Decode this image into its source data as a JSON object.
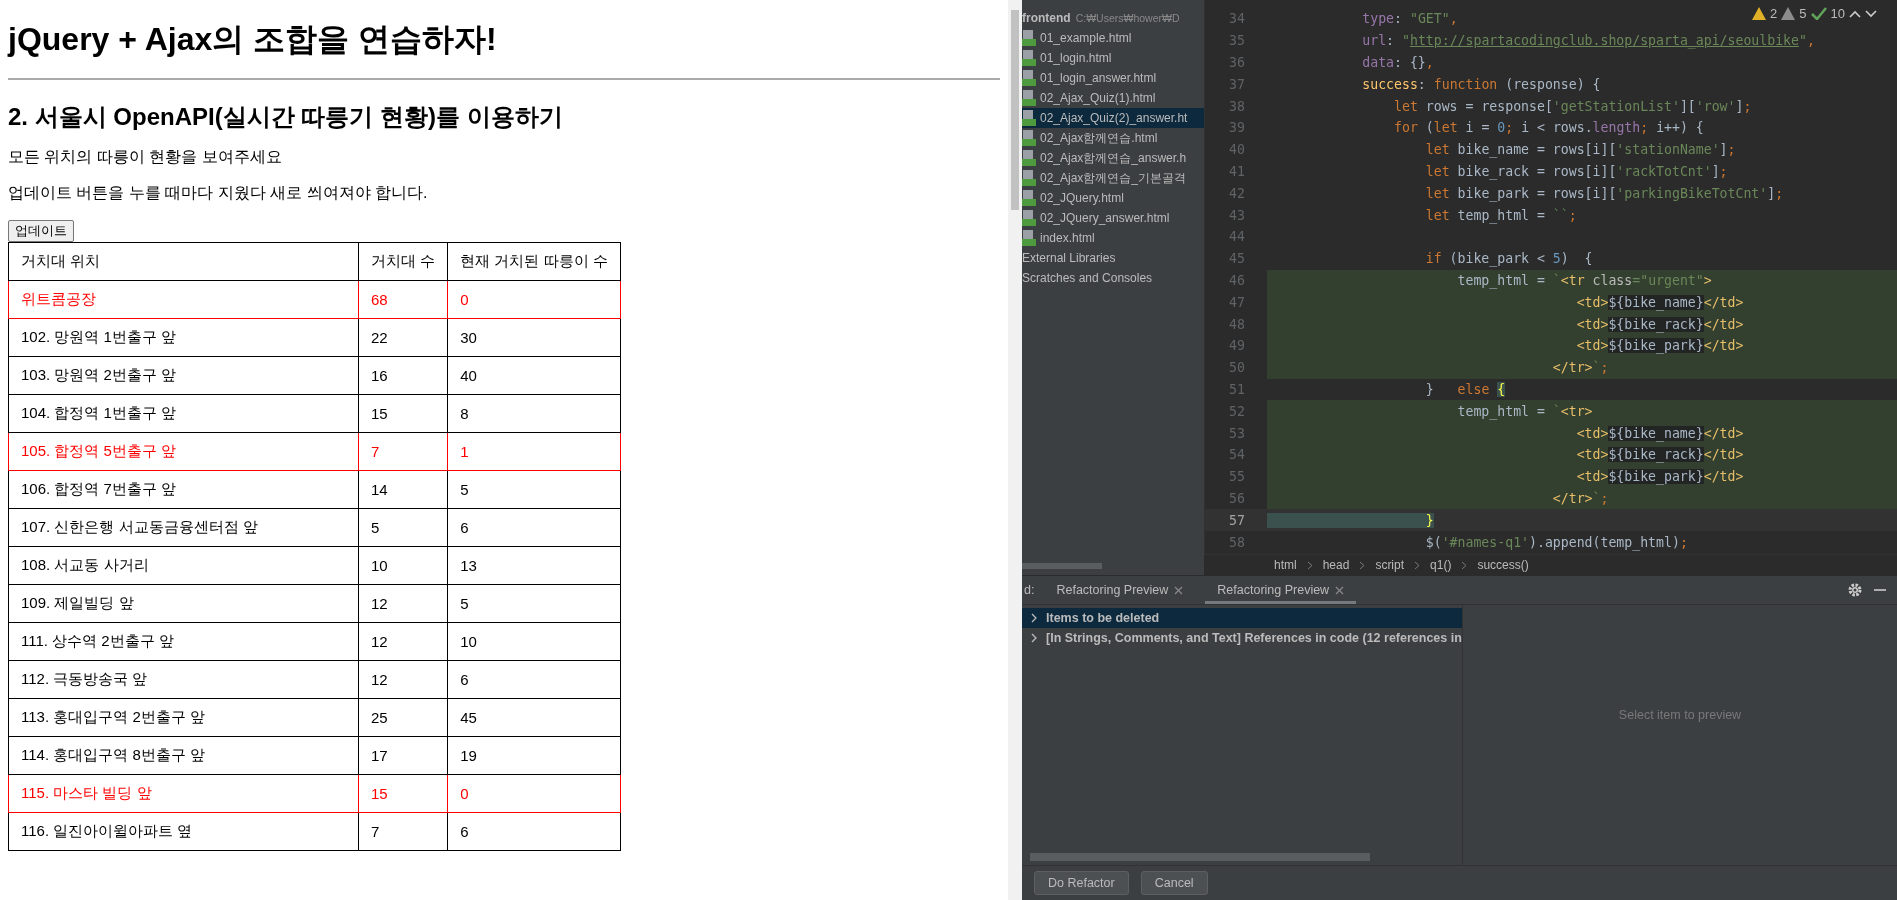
{
  "page": {
    "title": "jQuery + Ajax의 조합을 연습하자!",
    "subtitle": "2. 서울시 OpenAPI(실시간 따릉기 현황)를 이용하기",
    "paragraphs": [
      "모든 위치의 따릉이 현황을 보여주세요",
      "업데이트 버튼을 누를 때마다 지웠다 새로 씌여져야 합니다."
    ],
    "button": "업데이트",
    "table": {
      "columns": [
        "거치대 위치",
        "거치대 수",
        "현재 거치된 따릉이 수"
      ],
      "rows": [
        {
          "cells": [
            "위트콤공장",
            "68",
            "0"
          ],
          "urgent": true
        },
        {
          "cells": [
            "102. 망원역 1번출구 앞",
            "22",
            "30"
          ],
          "urgent": false
        },
        {
          "cells": [
            "103. 망원역 2번출구 앞",
            "16",
            "40"
          ],
          "urgent": false
        },
        {
          "cells": [
            "104. 합정역 1번출구 앞",
            "15",
            "8"
          ],
          "urgent": false
        },
        {
          "cells": [
            "105. 합정역 5번출구 앞",
            "7",
            "1"
          ],
          "urgent": true
        },
        {
          "cells": [
            "106. 합정역 7번출구 앞",
            "14",
            "5"
          ],
          "urgent": false
        },
        {
          "cells": [
            "107. 신한은행 서교동금융센터점 앞",
            "5",
            "6"
          ],
          "urgent": false
        },
        {
          "cells": [
            "108. 서교동 사거리",
            "10",
            "13"
          ],
          "urgent": false
        },
        {
          "cells": [
            "109. 제일빌딩 앞",
            "12",
            "5"
          ],
          "urgent": false
        },
        {
          "cells": [
            "111. 상수역 2번출구 앞",
            "12",
            "10"
          ],
          "urgent": false
        },
        {
          "cells": [
            "112. 극동방송국 앞",
            "12",
            "6"
          ],
          "urgent": false
        },
        {
          "cells": [
            "113. 홍대입구역 2번출구 앞",
            "25",
            "45"
          ],
          "urgent": false
        },
        {
          "cells": [
            "114. 홍대입구역 8번출구 앞",
            "17",
            "19"
          ],
          "urgent": false
        },
        {
          "cells": [
            "115. 마스타 빌딩 앞",
            "15",
            "0"
          ],
          "urgent": true
        },
        {
          "cells": [
            "116. 일진아이윌아파트 옆",
            "7",
            "6"
          ],
          "urgent": false
        }
      ]
    }
  },
  "project": {
    "root": "frontend",
    "path": "C:₩Users₩hower₩D",
    "files": [
      {
        "name": "01_example.html",
        "selected": false
      },
      {
        "name": "01_login.html",
        "selected": false
      },
      {
        "name": "01_login_answer.html",
        "selected": false
      },
      {
        "name": "02_Ajax_Quiz(1).html",
        "selected": false
      },
      {
        "name": "02_Ajax_Quiz(2)_answer.ht",
        "selected": true
      },
      {
        "name": "02_Ajax함께연습.html",
        "selected": false
      },
      {
        "name": "02_Ajax함께연습_answer.h",
        "selected": false
      },
      {
        "name": "02_Ajax함께연습_기본골격",
        "selected": false
      },
      {
        "name": "02_JQuery.html",
        "selected": false
      },
      {
        "name": "02_JQuery_answer.html",
        "selected": false
      },
      {
        "name": "index.html",
        "selected": false
      }
    ],
    "extra": [
      "External Libraries",
      "Scratches and Consoles"
    ]
  },
  "editor": {
    "inspections": {
      "warnings": "2",
      "weak_warnings": "5",
      "typos": "10"
    },
    "lines": [
      {
        "number": "34",
        "highlighted": false,
        "current": false,
        "tokens": [
          {
            "kind": "prop",
            "text": "            type"
          },
          {
            "kind": "plain",
            "text": ": "
          },
          {
            "kind": "string",
            "text": "\"GET\""
          },
          {
            "kind": "punct",
            "text": ","
          }
        ]
      },
      {
        "number": "35",
        "highlighted": false,
        "current": false,
        "tokens": [
          {
            "kind": "prop",
            "text": "            url"
          },
          {
            "kind": "plain",
            "text": ": "
          },
          {
            "kind": "string",
            "text": "\""
          },
          {
            "kind": "url",
            "text": "http://spartacodingclub.shop/sparta_api/seoulbike"
          },
          {
            "kind": "string",
            "text": "\""
          },
          {
            "kind": "punct",
            "text": ","
          }
        ]
      },
      {
        "number": "36",
        "highlighted": false,
        "current": false,
        "tokens": [
          {
            "kind": "prop",
            "text": "            data"
          },
          {
            "kind": "plain",
            "text": ": {}"
          },
          {
            "kind": "punct",
            "text": ","
          }
        ]
      },
      {
        "number": "37",
        "highlighted": false,
        "current": false,
        "tokens": [
          {
            "kind": "func",
            "text": "            success"
          },
          {
            "kind": "plain",
            "text": ": "
          },
          {
            "kind": "keyword",
            "text": "function"
          },
          {
            "kind": "plain",
            "text": " (response) {"
          }
        ]
      },
      {
        "number": "38",
        "highlighted": false,
        "current": false,
        "tokens": [
          {
            "kind": "keyword",
            "text": "                let"
          },
          {
            "kind": "plain",
            "text": " rows = response["
          },
          {
            "kind": "string",
            "text": "'getStationList'"
          },
          {
            "kind": "plain",
            "text": "]["
          },
          {
            "kind": "string",
            "text": "'row'"
          },
          {
            "kind": "plain",
            "text": "]"
          },
          {
            "kind": "punct",
            "text": ";"
          }
        ]
      },
      {
        "number": "39",
        "highlighted": false,
        "current": false,
        "tokens": [
          {
            "kind": "keyword",
            "text": "                for"
          },
          {
            "kind": "plain",
            "text": " ("
          },
          {
            "kind": "keyword",
            "text": "let"
          },
          {
            "kind": "plain",
            "text": " i = "
          },
          {
            "kind": "number",
            "text": "0"
          },
          {
            "kind": "punct",
            "text": ";"
          },
          {
            "kind": "plain",
            "text": " i < rows."
          },
          {
            "kind": "prop",
            "text": "length"
          },
          {
            "kind": "punct",
            "text": ";"
          },
          {
            "kind": "plain",
            "text": " i++) {"
          }
        ]
      },
      {
        "number": "40",
        "highlighted": false,
        "current": false,
        "tokens": [
          {
            "kind": "keyword",
            "text": "                    let"
          },
          {
            "kind": "plain",
            "text": " bike_name = rows[i]["
          },
          {
            "kind": "string",
            "text": "'stationName'"
          },
          {
            "kind": "plain",
            "text": "]"
          },
          {
            "kind": "punct",
            "text": ";"
          }
        ]
      },
      {
        "number": "41",
        "highlighted": false,
        "current": false,
        "tokens": [
          {
            "kind": "keyword",
            "text": "                    let"
          },
          {
            "kind": "plain",
            "text": " bike_rack = rows[i]["
          },
          {
            "kind": "string",
            "text": "'rackTotCnt'"
          },
          {
            "kind": "plain",
            "text": "]"
          },
          {
            "kind": "punct",
            "text": ";"
          }
        ]
      },
      {
        "number": "42",
        "highlighted": false,
        "current": false,
        "tokens": [
          {
            "kind": "keyword",
            "text": "                    let"
          },
          {
            "kind": "plain",
            "text": " bike_park = rows[i]["
          },
          {
            "kind": "string",
            "text": "'parkingBikeTotCnt'"
          },
          {
            "kind": "plain",
            "text": "]"
          },
          {
            "kind": "punct",
            "text": ";"
          }
        ]
      },
      {
        "number": "43",
        "highlighted": false,
        "current": false,
        "tokens": [
          {
            "kind": "keyword",
            "text": "                    let"
          },
          {
            "kind": "plain",
            "text": " temp_html = "
          },
          {
            "kind": "string",
            "text": "``"
          },
          {
            "kind": "punct",
            "text": ";"
          }
        ]
      },
      {
        "number": "44",
        "highlighted": false,
        "current": false
      },
      {
        "number": "45",
        "highlighted": false,
        "current": false,
        "tokens": [
          {
            "kind": "keyword",
            "text": "                    if"
          },
          {
            "kind": "plain",
            "text": " (bike_park < "
          },
          {
            "kind": "number",
            "text": "5"
          },
          {
            "kind": "plain",
            "text": ")  {"
          }
        ]
      },
      {
        "number": "46",
        "highlighted": true,
        "current": false,
        "tokens": [
          {
            "kind": "plain",
            "text": "                        temp_html = "
          },
          {
            "kind": "string",
            "text": "`"
          },
          {
            "kind": "tag",
            "text": "<tr "
          },
          {
            "kind": "attr",
            "text": "class"
          },
          {
            "kind": "string",
            "text": "=\"urgent\""
          },
          {
            "kind": "tag",
            "text": ">"
          }
        ]
      },
      {
        "number": "47",
        "highlighted": true,
        "current": false,
        "tokens": [
          {
            "kind": "tag",
            "text": "                                       <td>"
          },
          {
            "kind": "interp",
            "text": "${bike_name}"
          },
          {
            "kind": "tag",
            "text": "</td>"
          }
        ]
      },
      {
        "number": "48",
        "highlighted": true,
        "current": false,
        "tokens": [
          {
            "kind": "tag",
            "text": "                                       <td>"
          },
          {
            "kind": "interp",
            "text": "${bike_rack}"
          },
          {
            "kind": "tag",
            "text": "</td>"
          }
        ]
      },
      {
        "number": "49",
        "highlighted": true,
        "current": false,
        "tokens": [
          {
            "kind": "tag",
            "text": "                                       <td>"
          },
          {
            "kind": "interp",
            "text": "${bike_park}"
          },
          {
            "kind": "tag",
            "text": "</td>"
          }
        ]
      },
      {
        "number": "50",
        "highlighted": true,
        "current": false,
        "tokens": [
          {
            "kind": "tag",
            "text": "                                    </tr>"
          },
          {
            "kind": "string",
            "text": "`"
          },
          {
            "kind": "punct",
            "text": ";"
          }
        ]
      },
      {
        "number": "51",
        "highlighted": false,
        "current": false,
        "tokens": [
          {
            "kind": "plain",
            "text": "                    }   "
          },
          {
            "kind": "keyword",
            "text": "else "
          },
          {
            "kind": "brace",
            "text": "{"
          }
        ]
      },
      {
        "number": "52",
        "highlighted": true,
        "current": false,
        "tokens": [
          {
            "kind": "plain",
            "text": "                        temp_html = "
          },
          {
            "kind": "string",
            "text": "`"
          },
          {
            "kind": "tag",
            "text": "<tr>"
          }
        ]
      },
      {
        "number": "53",
        "highlighted": true,
        "current": false,
        "tokens": [
          {
            "kind": "tag",
            "text": "                                       <td>"
          },
          {
            "kind": "interp",
            "text": "${bike_name}"
          },
          {
            "kind": "tag",
            "text": "</td>"
          }
        ]
      },
      {
        "number": "54",
        "highlighted": true,
        "current": false,
        "tokens": [
          {
            "kind": "tag",
            "text": "                                       <td>"
          },
          {
            "kind": "interp",
            "text": "${bike_rack}"
          },
          {
            "kind": "tag",
            "text": "</td>"
          }
        ]
      },
      {
        "number": "55",
        "highlighted": true,
        "current": false,
        "tokens": [
          {
            "kind": "tag",
            "text": "                                       <td>"
          },
          {
            "kind": "interp",
            "text": "${bike_park}"
          },
          {
            "kind": "tag",
            "text": "</td>"
          }
        ]
      },
      {
        "number": "56",
        "highlighted": true,
        "current": false,
        "tokens": [
          {
            "kind": "tag",
            "text": "                                    </tr>"
          },
          {
            "kind": "string",
            "text": "`"
          },
          {
            "kind": "punct",
            "text": ";"
          }
        ]
      },
      {
        "number": "57",
        "highlighted": false,
        "current": true,
        "tokens": [
          {
            "kind": "brace",
            "text": "                    }"
          }
        ]
      },
      {
        "number": "58",
        "highlighted": false,
        "current": false,
        "tokens": [
          {
            "kind": "plain",
            "text": "                    $("
          },
          {
            "kind": "string",
            "text": "'#names-q1'"
          },
          {
            "kind": "plain",
            "text": ").append(temp_html)"
          },
          {
            "kind": "punct",
            "text": ";"
          }
        ]
      }
    ],
    "breadcrumbs": [
      "html",
      "head",
      "script",
      "q1()",
      "success()"
    ]
  },
  "bottom_panel": {
    "label": "d:",
    "tabs": [
      {
        "label": "Refactoring Preview",
        "selected": false
      },
      {
        "label": "Refactoring Preview",
        "selected": true
      }
    ],
    "tree": [
      {
        "label": "Items to be deleted",
        "selected": true,
        "expanded": false
      },
      {
        "label": "[In Strings, Comments, and Text] References in code  (12 references in",
        "selected": false,
        "expanded": false
      }
    ],
    "preview_hint": "Select item to preview",
    "buttons": [
      "Do Refactor",
      "Cancel"
    ]
  }
}
